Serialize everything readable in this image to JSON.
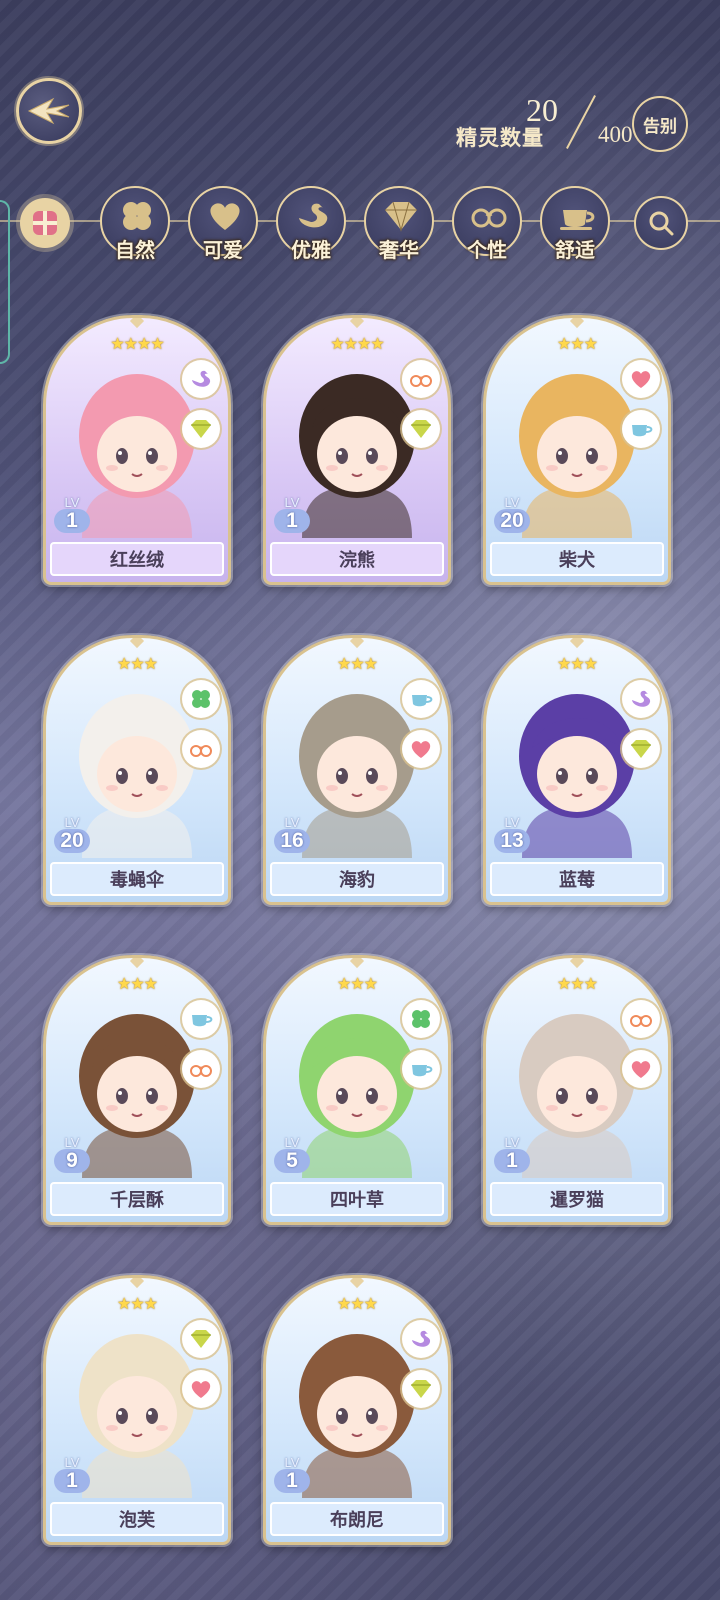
{
  "header": {
    "count_label": "精灵数量",
    "count_current": "20",
    "count_max": "400",
    "farewell_label": "告别"
  },
  "filters": [
    {
      "label": "自然",
      "icon": "clover-icon"
    },
    {
      "label": "可爱",
      "icon": "heart-icon"
    },
    {
      "label": "优雅",
      "icon": "swan-icon"
    },
    {
      "label": "奢华",
      "icon": "diamond-icon"
    },
    {
      "label": "个性",
      "icon": "glasses-icon"
    },
    {
      "label": "舒适",
      "icon": "teacup-icon"
    }
  ],
  "cards": [
    {
      "name": "红丝绒",
      "level": "1",
      "stars": "★★★★",
      "theme": "purple",
      "hair": "#f39ab0",
      "traits": [
        "swan-icon",
        "diamond-icon"
      ]
    },
    {
      "name": "浣熊",
      "level": "1",
      "stars": "★★★★",
      "theme": "purple",
      "hair": "#3b2a24",
      "traits": [
        "glasses-icon",
        "diamond-icon"
      ]
    },
    {
      "name": "柴犬",
      "level": "20",
      "stars": "★★★",
      "theme": "blue",
      "hair": "#e9b560",
      "traits": [
        "heart-icon",
        "teacup-icon"
      ]
    },
    {
      "name": "毒蝇伞",
      "level": "20",
      "stars": "★★★",
      "theme": "blue",
      "hair": "#f3f0ec",
      "traits": [
        "clover-icon",
        "glasses-icon"
      ]
    },
    {
      "name": "海豹",
      "level": "16",
      "stars": "★★★",
      "theme": "blue",
      "hair": "#a69c8c",
      "traits": [
        "teacup-icon",
        "heart-icon"
      ]
    },
    {
      "name": "蓝莓",
      "level": "13",
      "stars": "★★★",
      "theme": "blue",
      "hair": "#5b3fa6",
      "traits": [
        "swan-icon",
        "diamond-icon"
      ]
    },
    {
      "name": "千层酥",
      "level": "9",
      "stars": "★★★",
      "theme": "blue",
      "hair": "#7a5238",
      "traits": [
        "teacup-icon",
        "glasses-icon"
      ]
    },
    {
      "name": "四叶草",
      "level": "5",
      "stars": "★★★",
      "theme": "blue",
      "hair": "#8fd46f",
      "traits": [
        "clover-icon",
        "teacup-icon"
      ]
    },
    {
      "name": "暹罗猫",
      "level": "1",
      "stars": "★★★",
      "theme": "blue",
      "hair": "#d8cbc1",
      "traits": [
        "glasses-icon",
        "heart-icon"
      ]
    },
    {
      "name": "泡芙",
      "level": "1",
      "stars": "★★★",
      "theme": "blue",
      "hair": "#eee2c8",
      "traits": [
        "diamond-icon",
        "heart-icon"
      ]
    },
    {
      "name": "布朗尼",
      "level": "1",
      "stars": "★★★",
      "theme": "blue",
      "hair": "#8a5a3c",
      "traits": [
        "swan-icon",
        "diamond-icon"
      ]
    }
  ],
  "level_prefix": "LV",
  "colors": {
    "gold": "#e8d3a4",
    "card_purple": "#d9c8f5",
    "card_blue": "#d2e6fb",
    "star": "#ffd84a"
  }
}
